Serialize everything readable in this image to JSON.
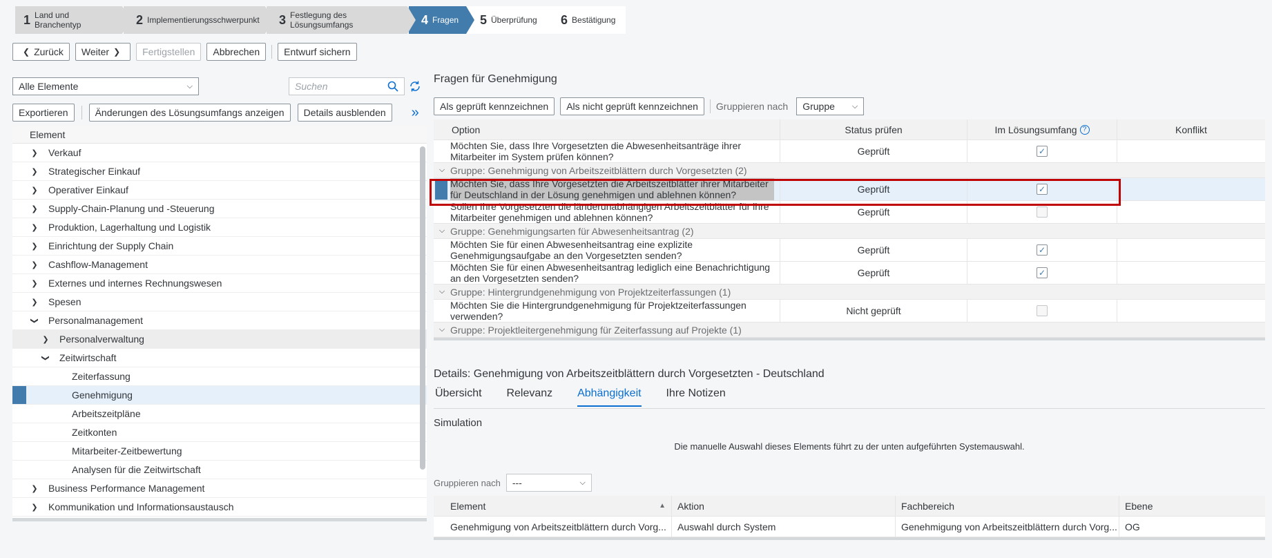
{
  "wizard": {
    "steps": [
      {
        "num": "1",
        "label": "Land und Branchentyp"
      },
      {
        "num": "2",
        "label": "Implementierungsschwerpunkt"
      },
      {
        "num": "3",
        "label": "Festlegung des Lösungsumfangs"
      },
      {
        "num": "4",
        "label": "Fragen"
      },
      {
        "num": "5",
        "label": "Überprüfung"
      },
      {
        "num": "6",
        "label": "Bestätigung"
      }
    ]
  },
  "toolbar": {
    "back": "Zurück",
    "next": "Weiter",
    "finish": "Fertigstellen",
    "cancel": "Abbrechen",
    "save_draft": "Entwurf sichern"
  },
  "left": {
    "filter_value": "Alle Elemente",
    "search_placeholder": "Suchen",
    "export": "Exportieren",
    "show_changes": "Änderungen des Lösungsumfangs anzeigen",
    "hide_details": "Details ausblenden",
    "column": "Element",
    "items": [
      "Verkauf",
      "Strategischer Einkauf",
      "Operativer Einkauf",
      "Supply-Chain-Planung und -Steuerung",
      "Produktion, Lagerhaltung und Logistik",
      "Einrichtung der Supply Chain",
      "Cashflow-Management",
      "Externes und internes Rechnungswesen",
      "Spesen",
      "Personalmanagement",
      "Personalverwaltung",
      "Zeitwirtschaft",
      "Zeiterfassung",
      "Genehmigung",
      "Arbeitszeitpläne",
      "Zeitkonten",
      "Mitarbeiter-Zeitbewertung",
      "Analysen für die Zeitwirtschaft",
      "Business Performance Management",
      "Kommunikation und Informationsaustausch"
    ]
  },
  "questions": {
    "title": "Fragen für Genehmigung",
    "mark_checked": "Als geprüft kennzeichnen",
    "mark_unchecked": "Als nicht geprüft kennzeichnen",
    "group_by_label": "Gruppieren nach",
    "group_by_value": "Gruppe",
    "columns": [
      "Option",
      "Status prüfen",
      "Im Lösungsumfang",
      "Konflikt"
    ],
    "rows": [
      {
        "option": "Möchten Sie, dass Ihre Vorgesetzten die Abwesenheitsanträge ihrer Mitarbeiter im System prüfen können?",
        "status": "Geprüft",
        "in_scope": true
      },
      {
        "group": "Gruppe: Genehmigung von Arbeitszeitblättern durch Vorgesetzten (2)"
      },
      {
        "option": "Möchten Sie, dass Ihre Vorgesetzten die Arbeitszeitblätter ihrer Mitarbeiter für Deutschland in der Lösung genehmigen und ablehnen können?",
        "status": "Geprüft",
        "in_scope": true
      },
      {
        "option": "Sollen Ihre Vorgesetzten die länderunabhängigen Arbeitszeitblätter für ihre Mitarbeiter genehmigen und ablehnen können?",
        "status": "Geprüft",
        "in_scope": false
      },
      {
        "group": "Gruppe: Genehmigungsarten für Abwesenheitsantrag (2)"
      },
      {
        "option": "Möchten Sie für einen Abwesenheitsantrag eine explizite Genehmigungsaufgabe an den Vorgesetzten senden?",
        "status": "Geprüft",
        "in_scope": true
      },
      {
        "option": "Möchten Sie für einen Abwesenheitsantrag lediglich eine Benachrichtigung an den Vorgesetzten senden?",
        "status": "Geprüft",
        "in_scope": true
      },
      {
        "group": "Gruppe: Hintergrundgenehmigung von Projektzeiterfassungen (1)"
      },
      {
        "option": "Möchten Sie die Hintergrundgenehmigung für Projektzeiterfassungen verwenden?",
        "status": "Nicht geprüft",
        "in_scope": false
      },
      {
        "group": "Gruppe: Projektleitergenehmigung für Zeiterfassung auf Projekte (1)"
      }
    ]
  },
  "details": {
    "title": "Details: Genehmigung von Arbeitszeitblättern durch Vorgesetzten - Deutschland",
    "tabs": [
      "Übersicht",
      "Relevanz",
      "Abhängigkeit",
      "Ihre Notizen"
    ],
    "simulation_title": "Simulation",
    "simulation_text": "Die manuelle Auswahl dieses Elements führt zu der unten aufgeführten Systemauswahl.",
    "group_by_label": "Gruppieren nach",
    "group_by_value": "---",
    "columns": [
      "Element",
      "Aktion",
      "Fachbereich",
      "Ebene"
    ],
    "row": [
      "Genehmigung von Arbeitszeitblättern durch Vorg...",
      "Auswahl durch System",
      "Genehmigung von Arbeitszeitblättern durch Vorg...",
      "OG"
    ]
  },
  "colors": {
    "accent": "#427cac",
    "link": "#0a6ed1",
    "highlight_border": "#c00000"
  }
}
